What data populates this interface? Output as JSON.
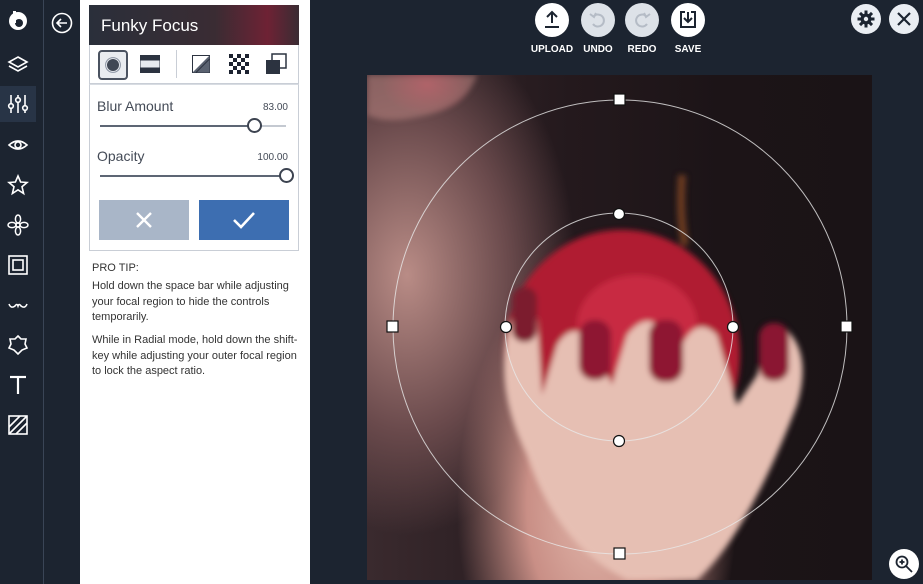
{
  "panel": {
    "title": "Funky Focus",
    "blur": {
      "label": "Blur Amount",
      "value": "83.00",
      "level": 0.83
    },
    "opacity": {
      "label": "Opacity",
      "value": "100.00",
      "level": 1.0
    },
    "pro_tip_heading": "PRO TIP:",
    "pro_tip_1": "Hold down the space bar while adjusting your focal region to hide the controls temporarily.",
    "pro_tip_2": "While in Radial mode, hold down the shift-key while adjusting your outer focal region to lock the aspect ratio."
  },
  "toolbar": {
    "upload": "UPLOAD",
    "undo": "UNDO",
    "redo": "REDO",
    "save": "SAVE"
  },
  "rail_icons": [
    "logo-icon",
    "layers-icon",
    "adjustments-icon",
    "eye-icon",
    "star-icon",
    "flower-icon",
    "frame-icon",
    "mustache-icon",
    "badge-icon",
    "text-icon",
    "texture-icon"
  ],
  "colors": {
    "confirm": "#3d6eb1",
    "cancel": "#a9b6c8",
    "background": "#1c2430"
  }
}
